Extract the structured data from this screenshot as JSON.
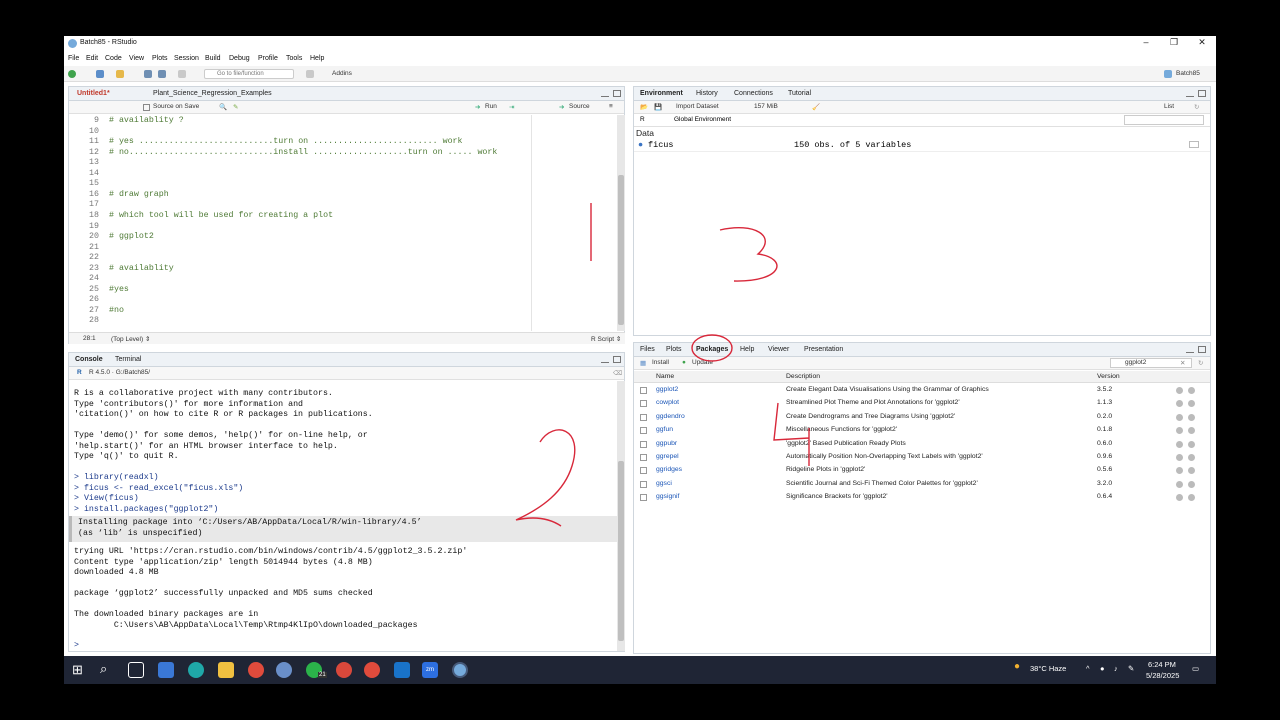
{
  "window": {
    "title": "Batch85 - RStudio",
    "minimize": "–",
    "maximize": "❐",
    "close": "✕"
  },
  "menu": [
    "File",
    "Edit",
    "Code",
    "View",
    "Plots",
    "Session",
    "Build",
    "Debug",
    "Profile",
    "Tools",
    "Help"
  ],
  "toolbar": {
    "goto_placeholder": "Go to file/function",
    "addins": "Addins",
    "project": "Batch85"
  },
  "editor": {
    "tabs": [
      "Untitled1*",
      "Plant_Science_Regression_Examples"
    ],
    "source_on_save": "Source on Save",
    "run": "Run",
    "source": "Source",
    "lines": [
      {
        "n": "9",
        "text": "# availablity ?"
      },
      {
        "n": "10",
        "text": ""
      },
      {
        "n": "11",
        "text": "# yes ...........................turn on ......................... work"
      },
      {
        "n": "12",
        "text": "# no.............................install ...................turn on ..... work"
      },
      {
        "n": "13",
        "text": ""
      },
      {
        "n": "14",
        "text": ""
      },
      {
        "n": "15",
        "text": ""
      },
      {
        "n": "16",
        "text": "# draw graph"
      },
      {
        "n": "17",
        "text": ""
      },
      {
        "n": "18",
        "text": "# which tool will be used for creating a plot"
      },
      {
        "n": "19",
        "text": ""
      },
      {
        "n": "20",
        "text": "# ggplot2"
      },
      {
        "n": "21",
        "text": ""
      },
      {
        "n": "22",
        "text": ""
      },
      {
        "n": "23",
        "text": "# availablity"
      },
      {
        "n": "24",
        "text": ""
      },
      {
        "n": "25",
        "text": "#yes"
      },
      {
        "n": "26",
        "text": ""
      },
      {
        "n": "27",
        "text": "#no"
      },
      {
        "n": "28",
        "text": ""
      }
    ],
    "status_pos": "28:1",
    "status_level": "(Top Level) ⇕",
    "status_type": "R Script ⇕"
  },
  "console": {
    "tabs": [
      "Console",
      "Terminal"
    ],
    "version": "R 4.5.0 · G:/Batch85/",
    "lines": [
      {
        "t": "R is a collaborative project with many contributors.",
        "k": "out"
      },
      {
        "t": "Type 'contributors()' for more information and",
        "k": "out"
      },
      {
        "t": "'citation()' on how to cite R or R packages in publications.",
        "k": "out"
      },
      {
        "t": "",
        "k": "out"
      },
      {
        "t": "Type 'demo()' for some demos, 'help()' for on-line help, or",
        "k": "out"
      },
      {
        "t": "'help.start()' for an HTML browser interface to help.",
        "k": "out"
      },
      {
        "t": "Type 'q()' to quit R.",
        "k": "out"
      },
      {
        "t": "",
        "k": "out"
      },
      {
        "t": "> library(readxl)",
        "k": "cmd"
      },
      {
        "t": "> ficus <- read_excel(\"ficus.xls\")",
        "k": "cmd"
      },
      {
        "t": "> View(ficus)",
        "k": "cmd"
      },
      {
        "t": "> install.packages(\"ggplot2\")",
        "k": "cmd"
      }
    ],
    "msg": [
      "Installing package into ‘C:/Users/AB/AppData/Local/R/win-library/4.5’",
      "(as ‘lib’ is unspecified)"
    ],
    "lines2": [
      "trying URL 'https://cran.rstudio.com/bin/windows/contrib/4.5/ggplot2_3.5.2.zip'",
      "Content type 'application/zip' length 5014944 bytes (4.8 MB)",
      "downloaded 4.8 MB",
      "",
      "package ‘ggplot2’ successfully unpacked and MD5 sums checked",
      "",
      "The downloaded binary packages are in",
      "        C:\\Users\\AB\\AppData\\Local\\Temp\\Rtmp4KlIpO\\downloaded_packages"
    ],
    "prompt": ">"
  },
  "environment": {
    "tabs": [
      "Environment",
      "History",
      "Connections",
      "Tutorial"
    ],
    "import": "Import Dataset",
    "memory": "157 MiB",
    "list": "List",
    "r": "R",
    "global": "Global Environment",
    "section": "Data",
    "rows": [
      {
        "name": "ficus",
        "value": "150 obs. of 5 variables"
      }
    ]
  },
  "files": {
    "tabs": [
      "Files",
      "Plots",
      "Packages",
      "Help",
      "Viewer",
      "Presentation"
    ],
    "install": "Install",
    "update": "Update",
    "search": "ggplot2",
    "headers": [
      "Name",
      "Description",
      "Version"
    ],
    "packages": [
      {
        "name": "ggplot2",
        "desc": "Create Elegant Data Visualisations Using the Grammar of Graphics",
        "ver": "3.5.2"
      },
      {
        "name": "cowplot",
        "desc": "Streamlined Plot Theme and Plot Annotations for 'ggplot2'",
        "ver": "1.1.3"
      },
      {
        "name": "ggdendro",
        "desc": "Create Dendrograms and Tree Diagrams Using 'ggplot2'",
        "ver": "0.2.0"
      },
      {
        "name": "ggfun",
        "desc": "Miscellaneous Functions for 'ggplot2'",
        "ver": "0.1.8"
      },
      {
        "name": "ggpubr",
        "desc": "'ggplot2' Based Publication Ready Plots",
        "ver": "0.6.0"
      },
      {
        "name": "ggrepel",
        "desc": "Automatically Position Non-Overlapping Text Labels with 'ggplot2'",
        "ver": "0.9.6"
      },
      {
        "name": "ggridges",
        "desc": "Ridgeline Plots in 'ggplot2'",
        "ver": "0.5.6"
      },
      {
        "name": "ggsci",
        "desc": "Scientific Journal and Sci-Fi Themed Color Palettes for 'ggplot2'",
        "ver": "3.2.0"
      },
      {
        "name": "ggsignif",
        "desc": "Significance Brackets for 'ggplot2'",
        "ver": "0.6.4"
      }
    ]
  },
  "taskbar": {
    "weather": "38°C  Haze",
    "time": "6:24 PM",
    "date": "5/28/2025",
    "zoom": "zm",
    "whatsapp_badge": "21"
  }
}
